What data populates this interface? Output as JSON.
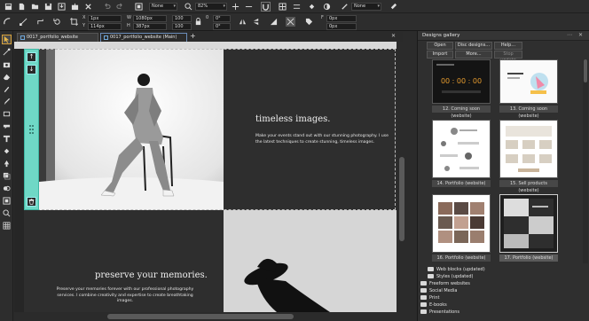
{
  "toolbar_top": {
    "style_value": "None",
    "zoom_value": "82%",
    "fill_value": "None"
  },
  "toolbar_props": {
    "x_label": "X",
    "x_value": "1px",
    "y_label": "Y",
    "y_value": "114px",
    "w_label": "W",
    "w_value": "1080px",
    "h_label": "H",
    "h_value": "387px",
    "sw_value": "100",
    "sh_value": "100",
    "rot_label": "0",
    "rot_value": "0°",
    "skew_value": "0°",
    "f_label": "F",
    "f_value": "0px",
    "fy_value": "0px"
  },
  "tabs": [
    {
      "label": "0017_portfolio_website (Website)"
    },
    {
      "label": "0017_portfolio_website (Main)"
    }
  ],
  "tab_add": "+",
  "canvas": {
    "heading1": "timeless images.",
    "body1": "Make your events stand out with our stunning photography. I use the latest techniques to create stunning, timeless images.",
    "heading2": "preserve your memories.",
    "body2": "Preserve your memories forever with our professional photography services. I combine creativity and expertise to create breathtaking images."
  },
  "gallery": {
    "title": "Designs gallery",
    "buttons": {
      "open": "Open",
      "disc": "Disc designs...",
      "help": "Help...",
      "import": "Import",
      "more": "More...",
      "stop": "Stop update"
    },
    "coming_soon_timer": "00 : 00 : 00",
    "thumbs": [
      {
        "label": "12. Coming soon (website)"
      },
      {
        "label": "13. Coming soon (website)"
      },
      {
        "label": "14. Portfolio (website)"
      },
      {
        "label": "15. Sell products (website)"
      },
      {
        "label": "16. Portfolio (website)"
      },
      {
        "label": "17. Portfolio (website)"
      }
    ],
    "tree": [
      {
        "label": "Web blocks (updated)"
      },
      {
        "label": "Styles (updated)"
      },
      {
        "label": "Freeform websites"
      },
      {
        "label": "Social Media"
      },
      {
        "label": "Print"
      },
      {
        "label": "E-books"
      },
      {
        "label": "Presentations"
      }
    ]
  }
}
